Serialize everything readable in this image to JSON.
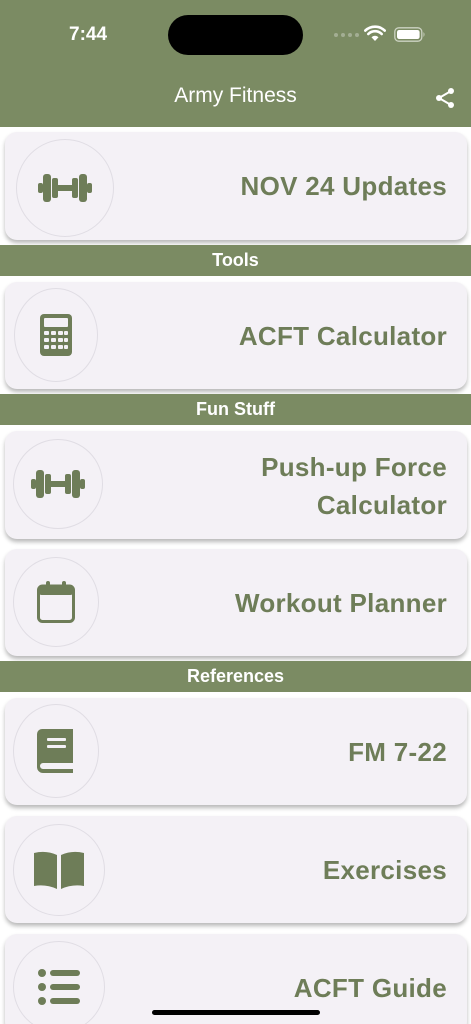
{
  "status_bar": {
    "time": "7:44"
  },
  "header": {
    "title": "Army Fitness",
    "share_icon": "share-icon"
  },
  "colors": {
    "accent": "#7b8b63",
    "label": "#6e7d58",
    "card": "#f4f1f6"
  },
  "cards": [
    {
      "label": "NOV 24 Updates",
      "icon": "dumbbell-icon"
    },
    {
      "label": "ACFT Calculator",
      "icon": "calculator-icon"
    },
    {
      "label": "Push-up Force\nCalculator",
      "icon": "dumbbell-icon"
    },
    {
      "label": "Workout Planner",
      "icon": "calendar-icon"
    },
    {
      "label": "FM 7-22",
      "icon": "book-icon"
    },
    {
      "label": "Exercises",
      "icon": "open-book-icon"
    },
    {
      "label": "ACFT Guide",
      "icon": "list-icon"
    }
  ],
  "sections": [
    {
      "label": "Tools"
    },
    {
      "label": "Fun Stuff"
    },
    {
      "label": "References"
    }
  ]
}
